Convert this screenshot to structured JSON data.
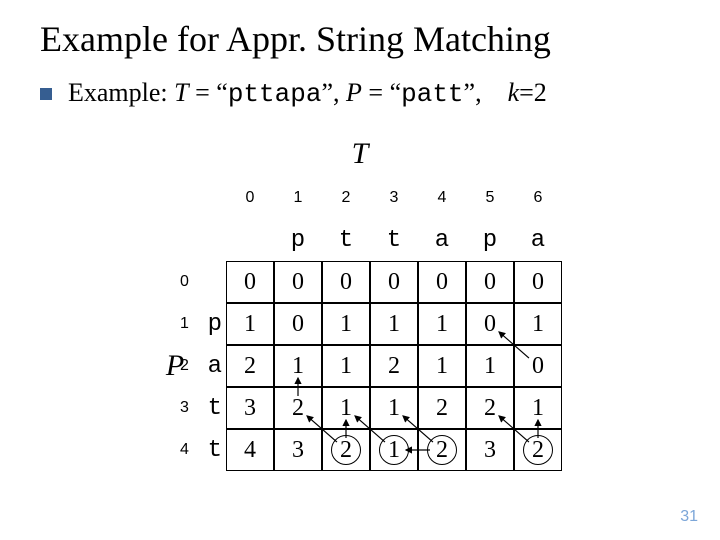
{
  "title": "Example for Appr. String Matching",
  "example": {
    "label": "Example:",
    "T_var": "T",
    "T_val": "pttapa",
    "P_var": "P",
    "P_val": "patt",
    "k_var": "k",
    "k_val": "2",
    "eq": "=",
    "open_q": "“",
    "close_q": "”",
    "comma": ",",
    "sep": " "
  },
  "labels": {
    "T": "T",
    "P": "P"
  },
  "col_indices": [
    "0",
    "1",
    "2",
    "3",
    "4",
    "5",
    "6"
  ],
  "t_letters": [
    "",
    "p",
    "t",
    "t",
    "a",
    "p",
    "a"
  ],
  "row_indices": [
    "0",
    "1",
    "2",
    "3",
    "4"
  ],
  "p_letters": [
    "",
    "p",
    "a",
    "t",
    "t"
  ],
  "dp": [
    [
      "0",
      "0",
      "0",
      "0",
      "0",
      "0",
      "0"
    ],
    [
      "1",
      "0",
      "1",
      "1",
      "1",
      "0",
      "1"
    ],
    [
      "2",
      "1",
      "1",
      "2",
      "1",
      "1",
      "0"
    ],
    [
      "3",
      "2",
      "1",
      "1",
      "2",
      "2",
      "1"
    ],
    [
      "4",
      "3",
      "2",
      "1",
      "2",
      "3",
      "2"
    ]
  ],
  "circled": [
    {
      "r": 4,
      "c": 2
    },
    {
      "r": 4,
      "c": 3
    },
    {
      "r": 4,
      "c": 4
    },
    {
      "r": 4,
      "c": 6
    }
  ],
  "slide_number": "31"
}
